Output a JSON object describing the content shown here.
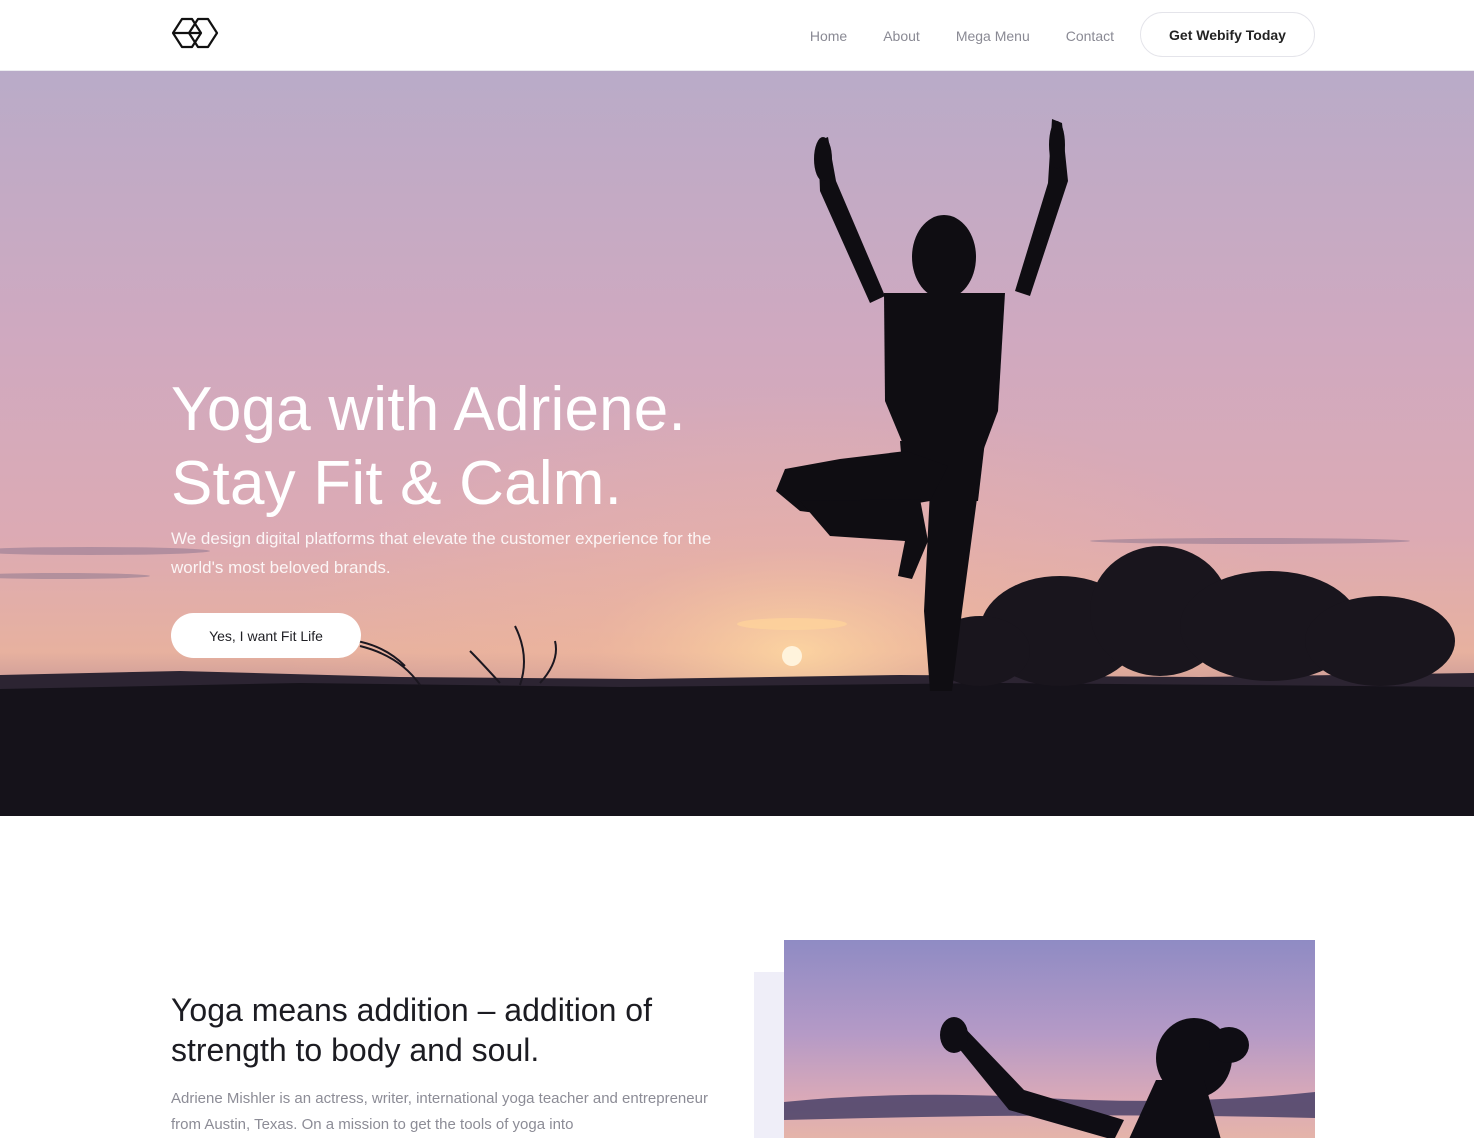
{
  "nav": {
    "logo": "logo-icon",
    "links": [
      "Home",
      "About",
      "Mega Menu",
      "Contact"
    ],
    "cta": "Get Webify Today"
  },
  "hero": {
    "title_line1": "Yoga with Adriene.",
    "title_line2": "Stay Fit & Calm.",
    "subtitle": "We design digital platforms that elevate the customer experience for the world's most beloved brands.",
    "button": "Yes, I want Fit Life"
  },
  "intro": {
    "title_line1": "Yoga means addition – addition of",
    "title_line2": "strength to body and soul.",
    "text": "Adriene Mishler is an actress, writer, international yoga teacher and entrepreneur from Austin, Texas. On a mission to get the tools of yoga into"
  },
  "colors": {
    "sky_top": "#b7a8c6",
    "sky_mid": "#dcaeb8",
    "sky_horizon": "#eeb69a",
    "ground": "#14121a",
    "accent_block": "#efeef8"
  }
}
